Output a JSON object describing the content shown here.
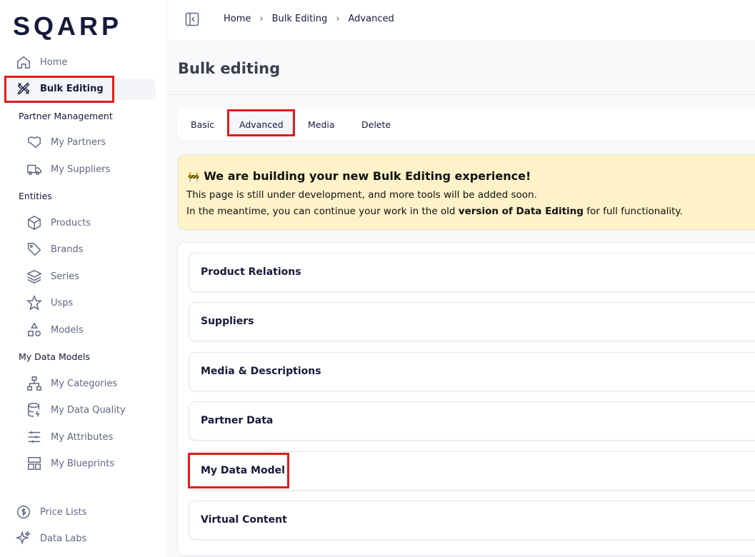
{
  "logo": "SQARP",
  "sidebar": {
    "home": "Home",
    "bulk_editing": "Bulk Editing",
    "partner_management": "Partner Management",
    "my_partners": "My Partners",
    "my_suppliers": "My Suppliers",
    "entities": "Entities",
    "products": "Products",
    "brands": "Brands",
    "series": "Series",
    "usps": "Usps",
    "models": "Models",
    "my_data_models": "My Data Models",
    "my_categories": "My Categories",
    "my_data_quality": "My Data Quality",
    "my_attributes": "My Attributes",
    "my_blueprints": "My Blueprints",
    "price_lists": "Price Lists",
    "data_labs": "Data Labs"
  },
  "breadcrumb": [
    "Home",
    "Bulk Editing",
    "Advanced"
  ],
  "page_title": "Bulk editing",
  "tabs": [
    "Basic",
    "Advanced",
    "Media",
    "Delete"
  ],
  "banner": {
    "emoji": "🚧",
    "title": "We are building your new Bulk Editing experience!",
    "line1": "This page is still under development, and more tools will be added soon.",
    "line2_pre": "In the meantime, you can continue your work in the old ",
    "line2_bold": "version of Data Editing",
    "line2_post": " for full functionality."
  },
  "sections": [
    "Product Relations",
    "Suppliers",
    "Media & Descriptions",
    "Partner Data",
    "My Data Model",
    "Virtual Content"
  ],
  "colors": {
    "highlight": "#e31b1b",
    "banner_bg": "#fdf2c8",
    "text": "#151a3a"
  }
}
